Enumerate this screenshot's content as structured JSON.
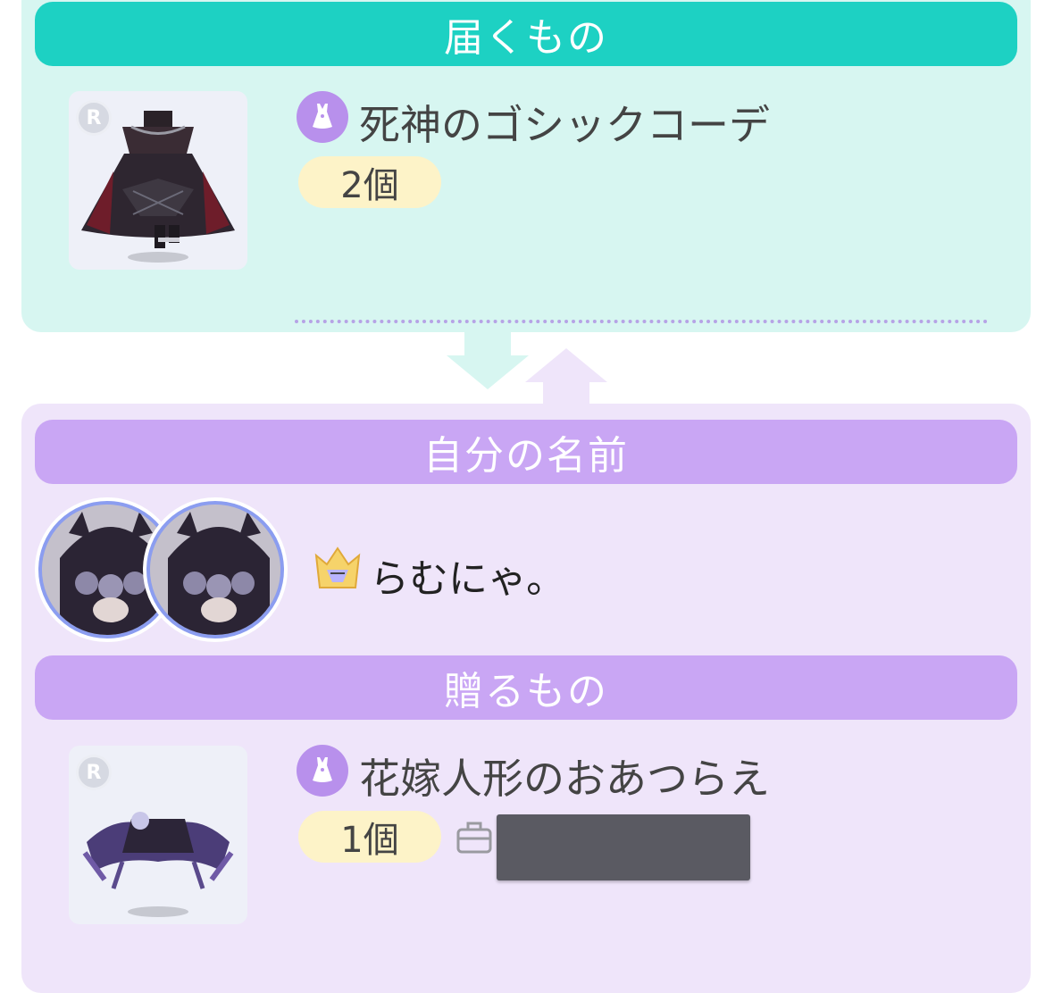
{
  "receive": {
    "header": "届くもの",
    "item": {
      "rarity": "R",
      "name": "死神のゴシックコーデ",
      "quantity": "2個"
    }
  },
  "sender": {
    "header": "自分の名前",
    "user_name": "らむにゃ。"
  },
  "send": {
    "header": "贈るもの",
    "item": {
      "rarity": "R",
      "name": "花嫁人形のおあつらえ",
      "quantity": "1個"
    }
  },
  "icons": {
    "category": "dress-icon",
    "inventory": "bag-icon",
    "title_badge": "crown-badge-icon"
  },
  "colors": {
    "receive_accent": "#1dd1c3",
    "receive_bg": "#d7f6f1",
    "send_accent": "#c9a6f4",
    "send_bg": "#efe5fa",
    "quantity_bg": "#fdf3c8"
  }
}
